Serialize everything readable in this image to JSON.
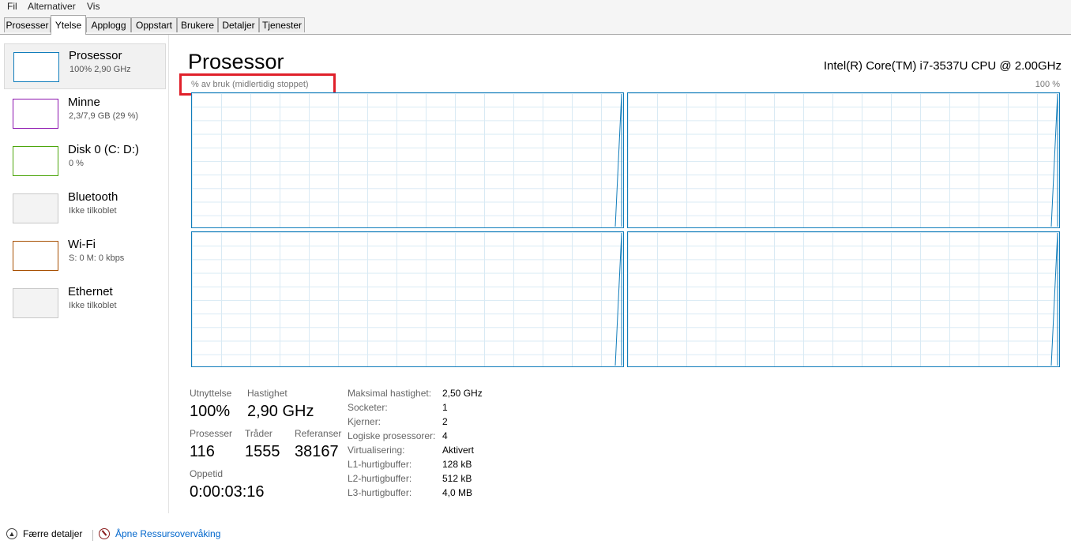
{
  "menu": [
    "Fil",
    "Alternativer",
    "Vis"
  ],
  "tabs": [
    "Prosesser",
    "Ytelse",
    "Applogg",
    "Oppstart",
    "Brukere",
    "Detaljer",
    "Tjenester"
  ],
  "active_tab": "Ytelse",
  "sidebar": [
    {
      "title": "Prosessor",
      "subtitle": "100%  2,90 GHz",
      "color": "#117dbb"
    },
    {
      "title": "Minne",
      "subtitle": "2,3/7,9 GB (29 %)",
      "color": "#8b12ae"
    },
    {
      "title": "Disk 0 (C: D:)",
      "subtitle": "0 %",
      "color": "#4da60c"
    },
    {
      "title": "Bluetooth",
      "subtitle": "Ikke tilkoblet",
      "color": "#c8c8c8"
    },
    {
      "title": "Wi-Fi",
      "subtitle": "S: 0  M: 0 kbps",
      "color": "#a74f01"
    },
    {
      "title": "Ethernet",
      "subtitle": "Ikke tilkoblet",
      "color": "#c8c8c8"
    }
  ],
  "main": {
    "title": "Prosessor",
    "cpu_model": "Intel(R) Core(TM) i7-3537U CPU @ 2.00GHz",
    "usage_label": "% av bruk (midlertidig stoppet)",
    "max_label": "100 %",
    "graph_color": "#117dbb"
  },
  "stats": {
    "utilization": {
      "label": "Utnyttelse",
      "value": "100%"
    },
    "speed": {
      "label": "Hastighet",
      "value": "2,90 GHz"
    },
    "processes": {
      "label": "Prosesser",
      "value": "116"
    },
    "threads": {
      "label": "Tråder",
      "value": "1555"
    },
    "handles": {
      "label": "Referanser",
      "value": "38167"
    },
    "uptime": {
      "label": "Oppetid",
      "value": "0:00:03:16"
    }
  },
  "specs": [
    {
      "label": "Maksimal hastighet:",
      "value": "2,50 GHz"
    },
    {
      "label": "Socketer:",
      "value": "1"
    },
    {
      "label": "Kjerner:",
      "value": "2"
    },
    {
      "label": "Logiske prosessorer:",
      "value": "4"
    },
    {
      "label": "Virtualisering:",
      "value": "Aktivert"
    },
    {
      "label": "L1-hurtigbuffer:",
      "value": "128 kB"
    },
    {
      "label": "L2-hurtigbuffer:",
      "value": "512 kB"
    },
    {
      "label": "L3-hurtigbuffer:",
      "value": "4,0 MB"
    }
  ],
  "footer": {
    "fewer_details": "Færre detaljer",
    "open_monitor": "Åpne Ressursovervåking"
  }
}
